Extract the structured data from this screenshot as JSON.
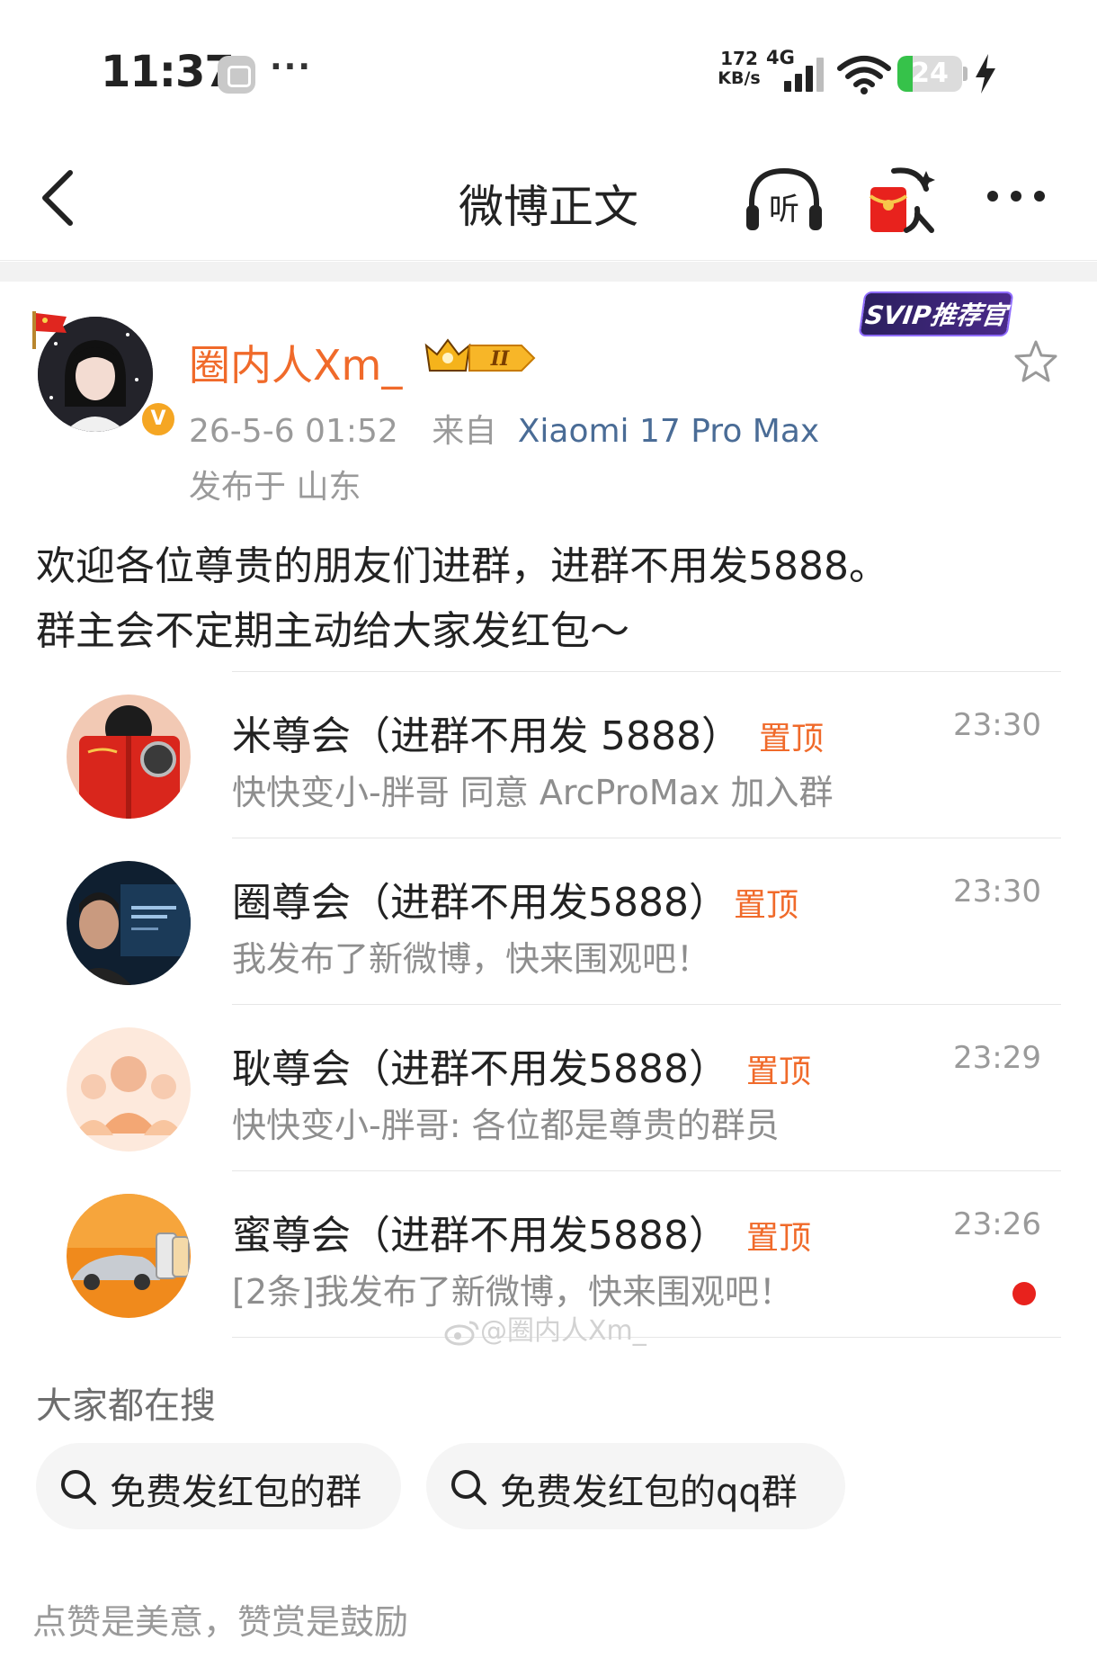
{
  "status_bar": {
    "time": "11:37",
    "more": "···",
    "net_speed_value": "172",
    "net_speed_unit": "KB/s",
    "network_type": "4G",
    "battery": "24",
    "battery_level": 0.24,
    "battery_color": "#36c24a"
  },
  "nav": {
    "title": "微博正文",
    "back_icon": "chevron-left-icon",
    "listen_icon": "headphones-listen-icon",
    "redpack_icon": "red-envelope-icon",
    "more_icon": "more-dots-icon"
  },
  "author": {
    "name": "圈内人Xm_",
    "svip_badge": "SVIP推荐官",
    "verified_badge": "V",
    "crown_level": "II",
    "timestamp": "26-5-6 01:52",
    "source_prefix": "来自",
    "device": "Xiaomi 17 Pro Max",
    "location": "发布于 山东",
    "name_color": "#f06a2a"
  },
  "post": {
    "line1": "欢迎各位尊贵的朋友们进群，进群不用发5888。",
    "line2": "群主会不定期主动给大家发红包～"
  },
  "groups": [
    {
      "name": "米尊会（进群不用发 5888）",
      "tag": "置顶",
      "time": "23:30",
      "message": "快快变小-胖哥 同意 ArcProMax 加入群",
      "unread": false
    },
    {
      "name": "圈尊会（进群不用发5888）",
      "tag": "置顶",
      "time": "23:30",
      "message": "我发布了新微博，快来围观吧！",
      "unread": false
    },
    {
      "name": "耿尊会（进群不用发5888）",
      "tag": "置顶",
      "time": "23:29",
      "message": "快快变小-胖哥: 各位都是尊贵的群员",
      "unread": false
    },
    {
      "name": "蜜尊会（进群不用发5888）",
      "tag": "置顶",
      "time": "23:26",
      "message": "[2条]我发布了新微博，快来围观吧！",
      "unread": true
    }
  ],
  "watermark": "@圈内人Xm_",
  "search": {
    "heading": "大家都在搜",
    "chips": [
      "免费发红包的群",
      "免费发红包的qq群"
    ]
  },
  "footer": {
    "reward_text": "点赞是美意，赞赏是鼓励"
  },
  "colors": {
    "accent": "#f06a2a",
    "link": "#4a6c96",
    "unread": "#e8221d"
  }
}
